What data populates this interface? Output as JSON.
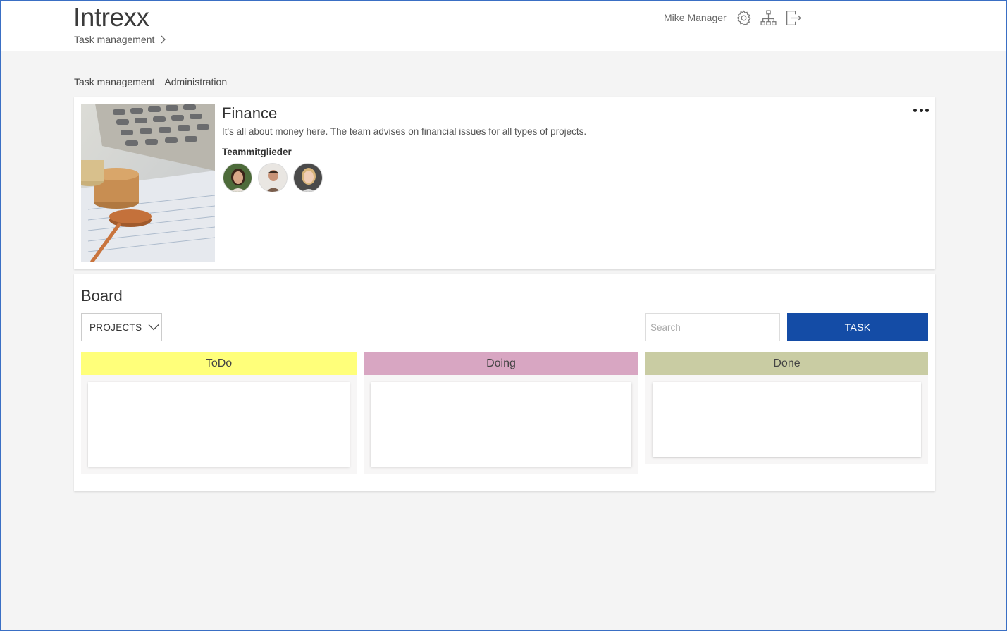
{
  "header": {
    "logo": "Intrexx",
    "breadcrumb": "Task management",
    "user_name": "Mike Manager",
    "icons": [
      "settings-icon",
      "sitemap-icon",
      "logout-icon"
    ]
  },
  "subnav": {
    "items": [
      "Task management",
      "Administration"
    ]
  },
  "team": {
    "title": "Finance",
    "description": "It's all about money here. The team advises on financial issues for all types of projects.",
    "members_label": "Teammitglieder",
    "members": [
      "member-1",
      "member-2",
      "member-3"
    ]
  },
  "board": {
    "title": "Board",
    "projects_label": "PROJECTS",
    "search_placeholder": "Search",
    "task_button": "TASK",
    "columns": [
      {
        "label": "ToDo",
        "color": "#ffff7a"
      },
      {
        "label": "Doing",
        "color": "#d8a6c2"
      },
      {
        "label": "Done",
        "color": "#c9cca3"
      }
    ]
  },
  "colors": {
    "accent": "#144ca6",
    "background": "#f4f4f4"
  }
}
